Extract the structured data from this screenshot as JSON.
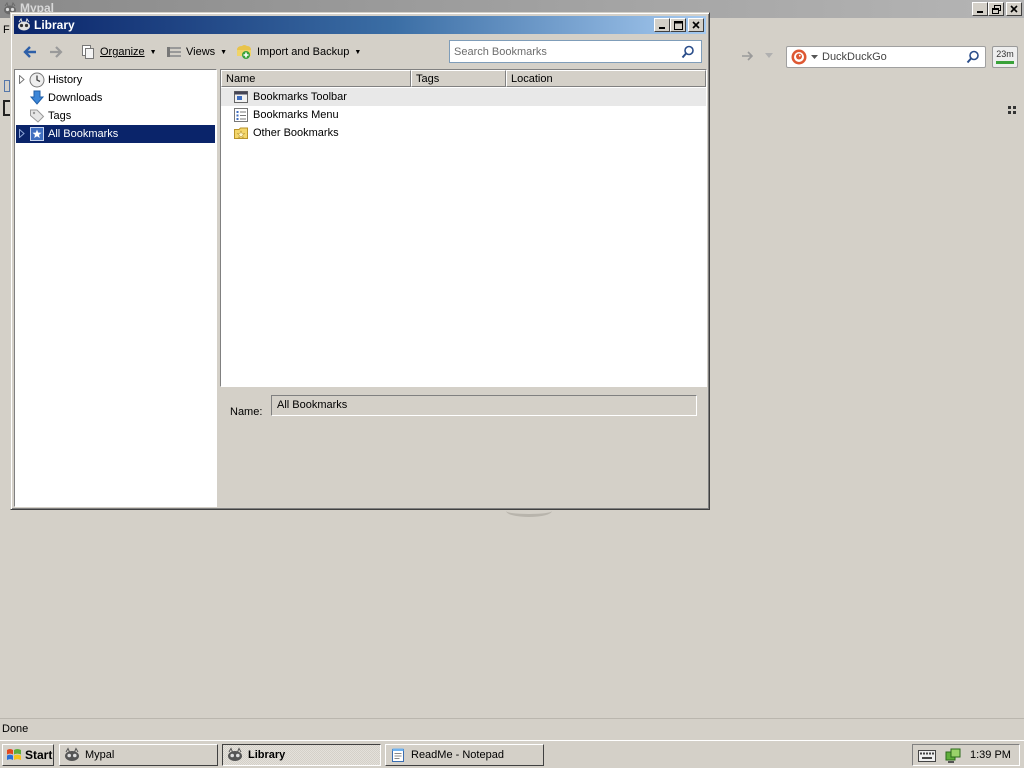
{
  "background_window": {
    "title": "Mypal",
    "search_engine": "DuckDuckGo",
    "timer_badge": "23m",
    "status_text": "Done"
  },
  "library": {
    "title": "Library",
    "toolbar": {
      "organize_label": "Organize",
      "views_label": "Views",
      "import_label": "Import and Backup"
    },
    "search": {
      "placeholder": "Search Bookmarks",
      "value": ""
    },
    "tree": {
      "items": [
        {
          "label": "History",
          "icon": "history-clock-icon",
          "has_children": true,
          "selected": false
        },
        {
          "label": "Downloads",
          "icon": "download-arrow-icon",
          "has_children": false,
          "selected": false
        },
        {
          "label": "Tags",
          "icon": "tag-icon",
          "has_children": false,
          "selected": false
        },
        {
          "label": "All Bookmarks",
          "icon": "bookmarks-star-icon",
          "has_children": true,
          "selected": true
        }
      ]
    },
    "list": {
      "columns": [
        "Name",
        "Tags",
        "Location"
      ],
      "rows": [
        {
          "name": "Bookmarks Toolbar",
          "icon": "bookmarks-toolbar-icon"
        },
        {
          "name": "Bookmarks Menu",
          "icon": "bookmarks-menu-icon"
        },
        {
          "name": "Other Bookmarks",
          "icon": "other-bookmarks-folder-icon"
        }
      ]
    },
    "details": {
      "name_label": "Name:",
      "name_value": "All Bookmarks"
    }
  },
  "taskbar": {
    "start_label": "Start",
    "tasks": [
      {
        "label": "Mypal",
        "active": false
      },
      {
        "label": "Library",
        "active": true
      },
      {
        "label": "ReadMe - Notepad",
        "active": false
      }
    ],
    "clock": "1:39 PM"
  },
  "colors": {
    "title_active_start": "#0a246a",
    "title_active_end": "#a6caf0",
    "selection": "#0a246a",
    "face": "#d4d0c8"
  }
}
